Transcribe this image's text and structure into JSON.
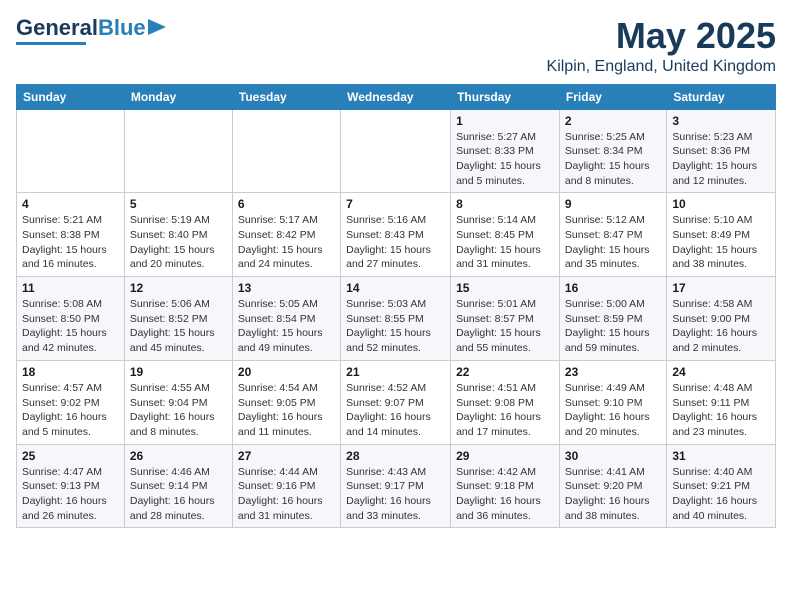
{
  "header": {
    "logo_general": "General",
    "logo_blue": "Blue",
    "month_year": "May 2025",
    "location": "Kilpin, England, United Kingdom"
  },
  "weekdays": [
    "Sunday",
    "Monday",
    "Tuesday",
    "Wednesday",
    "Thursday",
    "Friday",
    "Saturday"
  ],
  "weeks": [
    [
      {
        "day": "",
        "detail": ""
      },
      {
        "day": "",
        "detail": ""
      },
      {
        "day": "",
        "detail": ""
      },
      {
        "day": "",
        "detail": ""
      },
      {
        "day": "1",
        "detail": "Sunrise: 5:27 AM\nSunset: 8:33 PM\nDaylight: 15 hours\nand 5 minutes."
      },
      {
        "day": "2",
        "detail": "Sunrise: 5:25 AM\nSunset: 8:34 PM\nDaylight: 15 hours\nand 8 minutes."
      },
      {
        "day": "3",
        "detail": "Sunrise: 5:23 AM\nSunset: 8:36 PM\nDaylight: 15 hours\nand 12 minutes."
      }
    ],
    [
      {
        "day": "4",
        "detail": "Sunrise: 5:21 AM\nSunset: 8:38 PM\nDaylight: 15 hours\nand 16 minutes."
      },
      {
        "day": "5",
        "detail": "Sunrise: 5:19 AM\nSunset: 8:40 PM\nDaylight: 15 hours\nand 20 minutes."
      },
      {
        "day": "6",
        "detail": "Sunrise: 5:17 AM\nSunset: 8:42 PM\nDaylight: 15 hours\nand 24 minutes."
      },
      {
        "day": "7",
        "detail": "Sunrise: 5:16 AM\nSunset: 8:43 PM\nDaylight: 15 hours\nand 27 minutes."
      },
      {
        "day": "8",
        "detail": "Sunrise: 5:14 AM\nSunset: 8:45 PM\nDaylight: 15 hours\nand 31 minutes."
      },
      {
        "day": "9",
        "detail": "Sunrise: 5:12 AM\nSunset: 8:47 PM\nDaylight: 15 hours\nand 35 minutes."
      },
      {
        "day": "10",
        "detail": "Sunrise: 5:10 AM\nSunset: 8:49 PM\nDaylight: 15 hours\nand 38 minutes."
      }
    ],
    [
      {
        "day": "11",
        "detail": "Sunrise: 5:08 AM\nSunset: 8:50 PM\nDaylight: 15 hours\nand 42 minutes."
      },
      {
        "day": "12",
        "detail": "Sunrise: 5:06 AM\nSunset: 8:52 PM\nDaylight: 15 hours\nand 45 minutes."
      },
      {
        "day": "13",
        "detail": "Sunrise: 5:05 AM\nSunset: 8:54 PM\nDaylight: 15 hours\nand 49 minutes."
      },
      {
        "day": "14",
        "detail": "Sunrise: 5:03 AM\nSunset: 8:55 PM\nDaylight: 15 hours\nand 52 minutes."
      },
      {
        "day": "15",
        "detail": "Sunrise: 5:01 AM\nSunset: 8:57 PM\nDaylight: 15 hours\nand 55 minutes."
      },
      {
        "day": "16",
        "detail": "Sunrise: 5:00 AM\nSunset: 8:59 PM\nDaylight: 15 hours\nand 59 minutes."
      },
      {
        "day": "17",
        "detail": "Sunrise: 4:58 AM\nSunset: 9:00 PM\nDaylight: 16 hours\nand 2 minutes."
      }
    ],
    [
      {
        "day": "18",
        "detail": "Sunrise: 4:57 AM\nSunset: 9:02 PM\nDaylight: 16 hours\nand 5 minutes."
      },
      {
        "day": "19",
        "detail": "Sunrise: 4:55 AM\nSunset: 9:04 PM\nDaylight: 16 hours\nand 8 minutes."
      },
      {
        "day": "20",
        "detail": "Sunrise: 4:54 AM\nSunset: 9:05 PM\nDaylight: 16 hours\nand 11 minutes."
      },
      {
        "day": "21",
        "detail": "Sunrise: 4:52 AM\nSunset: 9:07 PM\nDaylight: 16 hours\nand 14 minutes."
      },
      {
        "day": "22",
        "detail": "Sunrise: 4:51 AM\nSunset: 9:08 PM\nDaylight: 16 hours\nand 17 minutes."
      },
      {
        "day": "23",
        "detail": "Sunrise: 4:49 AM\nSunset: 9:10 PM\nDaylight: 16 hours\nand 20 minutes."
      },
      {
        "day": "24",
        "detail": "Sunrise: 4:48 AM\nSunset: 9:11 PM\nDaylight: 16 hours\nand 23 minutes."
      }
    ],
    [
      {
        "day": "25",
        "detail": "Sunrise: 4:47 AM\nSunset: 9:13 PM\nDaylight: 16 hours\nand 26 minutes."
      },
      {
        "day": "26",
        "detail": "Sunrise: 4:46 AM\nSunset: 9:14 PM\nDaylight: 16 hours\nand 28 minutes."
      },
      {
        "day": "27",
        "detail": "Sunrise: 4:44 AM\nSunset: 9:16 PM\nDaylight: 16 hours\nand 31 minutes."
      },
      {
        "day": "28",
        "detail": "Sunrise: 4:43 AM\nSunset: 9:17 PM\nDaylight: 16 hours\nand 33 minutes."
      },
      {
        "day": "29",
        "detail": "Sunrise: 4:42 AM\nSunset: 9:18 PM\nDaylight: 16 hours\nand 36 minutes."
      },
      {
        "day": "30",
        "detail": "Sunrise: 4:41 AM\nSunset: 9:20 PM\nDaylight: 16 hours\nand 38 minutes."
      },
      {
        "day": "31",
        "detail": "Sunrise: 4:40 AM\nSunset: 9:21 PM\nDaylight: 16 hours\nand 40 minutes."
      }
    ]
  ]
}
